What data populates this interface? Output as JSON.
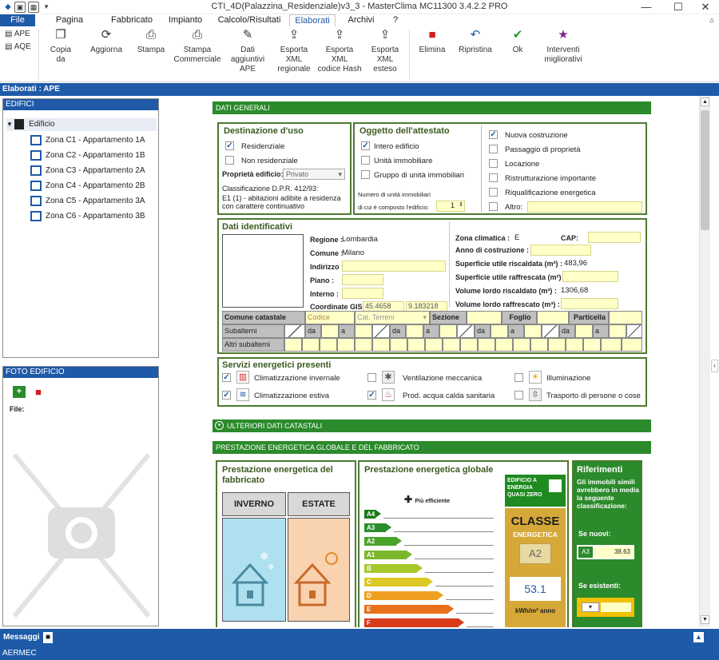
{
  "window": {
    "title": "CTI_4D(Palazzina_Residenziale)v3_3 - MasterClima MC11300 3.4.2.2 PRO",
    "minimize": "—",
    "maximize": "☐",
    "close": "✕"
  },
  "menu": {
    "tabs": [
      "File",
      "Pagina iniziale",
      "Fabbricato",
      "Impianto",
      "Calcolo/Risultati",
      "Elaborati",
      "Archivi",
      "?"
    ],
    "active": "Elaborati"
  },
  "ribbon": {
    "side_links": [
      "APE",
      "AQE"
    ],
    "buttons": [
      {
        "label": "Copia\nda",
        "icon": "copy-icon"
      },
      {
        "label": "Aggiorna",
        "icon": "refresh-icon"
      },
      {
        "label": "Stampa",
        "icon": "print-icon"
      },
      {
        "label": "Stampa\nCommerciale",
        "icon": "print-icon"
      },
      {
        "label": "Dati\naggiuntivi APE",
        "icon": "edit-document-icon"
      },
      {
        "label": "Esporta XML\nregionale",
        "icon": "export-icon"
      },
      {
        "label": "Esporta XML\ncodice Hash",
        "icon": "export-icon"
      },
      {
        "label": "Esporta XML\nesteso",
        "icon": "export-icon"
      },
      {
        "label": "Elimina",
        "icon": "trash-icon"
      },
      {
        "label": "Ripristina",
        "icon": "undo-icon"
      },
      {
        "label": "Ok",
        "icon": "check-icon"
      },
      {
        "label": "Interventi\nmigliorativi",
        "icon": "star-badge-icon"
      }
    ]
  },
  "breadcrumb": "Elaborati : APE",
  "edifici": {
    "header": "EDIFICI",
    "root": "Edificio",
    "zones": [
      "Zona C1 - Appartamento 1A",
      "Zona C2 - Appartamento 1B",
      "Zona C3 - Appartamento 2A",
      "Zona C4 - Appartamento 2B",
      "Zona C5 - Appartamento 3A",
      "Zona C6 - Appartamento 3B"
    ]
  },
  "foto": {
    "header": "FOTO EDIFICIO",
    "file_label": "File:"
  },
  "dati_generali": {
    "bar": "DATI GENERALI",
    "destinazione": {
      "title": "Destinazione d'uso",
      "residenziale": "Residenziale",
      "non_residenziale": "Non residenziale",
      "proprieta_label": "Proprietà edificio:",
      "proprieta_value": "Privato",
      "classificazione_label": "Classificazione D.P.R. 412/93:",
      "classificazione_text": "E1 (1) - abitazioni adibite a residenza con carattere continuativo"
    },
    "oggetto": {
      "title": "Oggetto dell'attestato",
      "intero": "Intero edificio",
      "unita": "Unità immobiliare",
      "gruppo": "Gruppo di unità immobiliari",
      "numero_label1": "Numero di unità immobiliari",
      "numero_label2": "di cui è composto l'edificio:",
      "numero_value": "1",
      "nuova": "Nuova costruzione",
      "passaggio": "Passaggio di proprietà",
      "locazione": "Locazione",
      "ristrutturazione": "Ristrutturazione importante",
      "riqualificazione": "Riqualificazione energetica",
      "altro": "Altro:"
    }
  },
  "dati_identificativi": {
    "title": "Dati identificativi",
    "regione_label": "Regione :",
    "regione": "Lombardia",
    "comune_label": "Comune :",
    "comune": "Milano",
    "indirizzo_label": "Indirizzo :",
    "piano_label": "Piano :",
    "interno_label": "Interno :",
    "gis_label": "Coordinate GIS :",
    "gis_lat": "45.4658",
    "gis_lon": "9.183218",
    "zona_label": "Zona climatica :",
    "zona": "E",
    "cap_label": "CAP:",
    "anno_label": "Anno di costruzione :",
    "sup_risc_label": "Superficie utile riscaldata (m²) :",
    "sup_risc": "483,96",
    "sup_raff_label": "Superficie utile raffrescata (m²) :",
    "vol_risc_label": "Volume lordo riscaldato (m³) :",
    "vol_risc": "1306,68",
    "vol_raff_label": "Volume lordo raffrescato (m³) :",
    "catasto": {
      "comune": "Comune catastale",
      "codice": "Codice",
      "cat": "Cat. Terreni",
      "sezione": "Sezione",
      "foglio": "Foglio",
      "particella": "Particella",
      "subalterni": "Subalterni",
      "altri": "Altri subalterni",
      "da": "da",
      "a": "a"
    }
  },
  "servizi": {
    "title": "Servizi energetici presenti",
    "items": [
      {
        "label": "Climatizzazione invernale",
        "checked": true
      },
      {
        "label": "Climatizzazione estiva",
        "checked": true
      },
      {
        "label": "Ventilazione meccanica",
        "checked": false
      },
      {
        "label": "Prod. acqua calda sanitaria",
        "checked": true
      },
      {
        "label": "Illuminazione",
        "checked": false
      },
      {
        "label": "Trasporto di persone o cose",
        "checked": false
      }
    ]
  },
  "ulteriori": "ULTERIORI DATI CATASTALI",
  "prestazione": {
    "bar": "PRESTAZIONE ENERGETICA GLOBALE E DEL FABBRICATO",
    "fabbricato_title": "Prestazione energetica del fabbricato",
    "inverno": "INVERNO",
    "estate": "ESTATE",
    "globale_title": "Prestazione energetica globale",
    "piu_efficiente": "Più efficiente",
    "classes": [
      "A4",
      "A3",
      "A2",
      "A1",
      "B",
      "C",
      "D",
      "E",
      "F"
    ],
    "nzeb": "EDIFICIO A ENERGIA QUASI ZERO",
    "classe_title": "CLASSE",
    "classe_sub": "ENERGETICA",
    "classe_value": "A2",
    "valore": "53.1",
    "unita": "kWh/m² anno",
    "riferimenti_title": "Riferimenti",
    "riferimenti_text": "Gli immobili simili avrebbero in media la seguente classificazione:",
    "se_nuovi": "Se nuovi:",
    "nuovi_class": "A3",
    "nuovi_value": "38.63",
    "se_esistenti": "Se esistenti:"
  },
  "messaggi": "Messaggi",
  "status": "AERMEC",
  "colors": {
    "accent": "#1e5aa8",
    "green": "#2b8a2b",
    "field": "#ffffc8"
  }
}
